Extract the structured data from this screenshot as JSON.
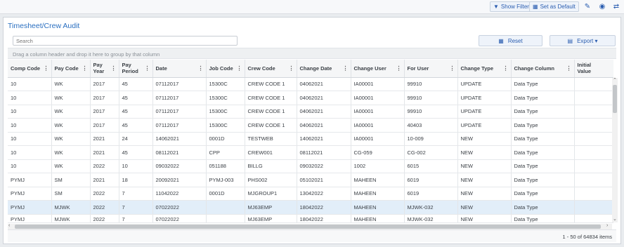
{
  "topbar": {
    "show_filter": "Show Filter",
    "set_default": "Set as Default"
  },
  "panel": {
    "title": "Timesheet/Crew Audit",
    "search_placeholder": "Search",
    "reset": "Reset",
    "export": "Export ▾",
    "group_hint": "Drag a column header and drop it here to group by that column"
  },
  "grid": {
    "columns": [
      "Comp Code",
      "Pay Code",
      "Pay Year",
      "Pay Period",
      "Date",
      "Job Code",
      "Crew Code",
      "Change Date",
      "Change User",
      "For User",
      "Change Type",
      "Change Column",
      "Initial Value"
    ],
    "rows": [
      [
        "10",
        "WK",
        "2017",
        "45",
        "07112017",
        "15300C",
        "CREW CODE 1",
        "04062021",
        "IA00001",
        "99910",
        "UPDATE",
        "Data Type",
        ""
      ],
      [
        "10",
        "WK",
        "2017",
        "45",
        "07112017",
        "15300C",
        "CREW CODE 1",
        "04062021",
        "IA00001",
        "99910",
        "UPDATE",
        "Data Type",
        ""
      ],
      [
        "10",
        "WK",
        "2017",
        "45",
        "07112017",
        "15300C",
        "CREW CODE 1",
        "04062021",
        "IA00001",
        "99910",
        "UPDATE",
        "Data Type",
        ""
      ],
      [
        "10",
        "WK",
        "2017",
        "45",
        "07112017",
        "15300C",
        "CREW CODE 1",
        "04062021",
        "IA00001",
        "40403",
        "UPDATE",
        "Data Type",
        ""
      ],
      [
        "10",
        "WK",
        "2021",
        "24",
        "14062021",
        "0001D",
        "TESTWEB",
        "14062021",
        "IA00001",
        "10-009",
        "NEW",
        "Data Type",
        ""
      ],
      [
        "10",
        "WK",
        "2021",
        "45",
        "08112021",
        "CPP",
        "CREW001",
        "08112021",
        "CG-059",
        "CG-002",
        "NEW",
        "Data Type",
        ""
      ],
      [
        "10",
        "WK",
        "2022",
        "10",
        "09032022",
        "051188",
        "BILLG",
        "09032022",
        "1002",
        "6015",
        "NEW",
        "Data Type",
        ""
      ],
      [
        "PYMJ",
        "SM",
        "2021",
        "18",
        "20092021",
        "PYMJ-003",
        "PHS002",
        "05102021",
        "MAHEEN",
        "6019",
        "NEW",
        "Data Type",
        ""
      ],
      [
        "PYMJ",
        "SM",
        "2022",
        "7",
        "11042022",
        "0001D",
        "MJGROUP1",
        "13042022",
        "MAHEEN",
        "6019",
        "NEW",
        "Data Type",
        ""
      ],
      [
        "PYMJ",
        "MJWK",
        "2022",
        "7",
        "07022022",
        "",
        "MJ63EMP",
        "18042022",
        "MAHEEN",
        "MJWK-032",
        "NEW",
        "Data Type",
        ""
      ],
      [
        "PYMJ",
        "MJWK",
        "2022",
        "7",
        "07022022",
        "",
        "MJ63EMP",
        "18042022",
        "MAHEEN",
        "MJWK-032",
        "NEW",
        "Data Type",
        ""
      ]
    ],
    "selected_row": 9
  },
  "footer": {
    "pager": "1 - 50 of 64834 items"
  }
}
